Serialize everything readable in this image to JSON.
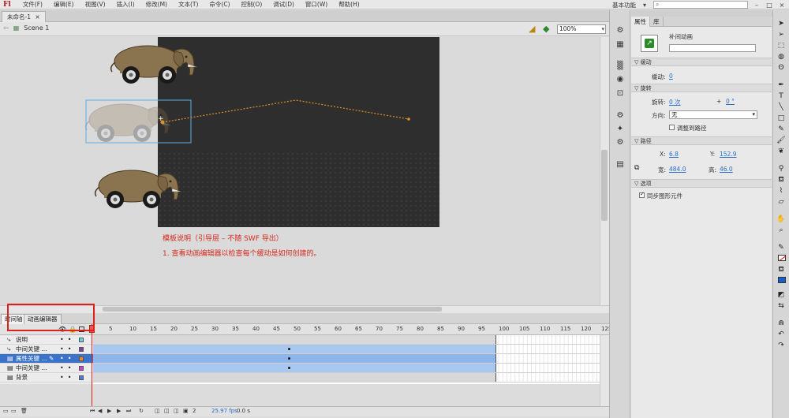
{
  "menubar": {
    "logo": "Fl",
    "items": [
      "文件(F)",
      "编辑(E)",
      "视图(V)",
      "插入(I)",
      "修改(M)",
      "文本(T)",
      "命令(C)",
      "控制(O)",
      "调试(D)",
      "窗口(W)",
      "帮助(H)"
    ],
    "workspace": "基本功能",
    "search_placeholder": ""
  },
  "document": {
    "tab_label": "未命名-1",
    "scene_label": "Scene 1",
    "zoom": "100%"
  },
  "stage": {
    "note_title": "模板说明（引导层 – 不随 SWF 导出）",
    "note_line1": "1. 查看动画编辑器以检查每个缓动是如何创建的。"
  },
  "timeline": {
    "tabs": [
      "时间轴",
      "动画编辑器"
    ],
    "ruler": [
      "5",
      "10",
      "15",
      "20",
      "25",
      "30",
      "35",
      "40",
      "45",
      "50",
      "55",
      "60",
      "65",
      "70",
      "75",
      "80",
      "85",
      "90",
      "95",
      "100",
      "105",
      "110",
      "115",
      "120",
      "125"
    ],
    "layers": [
      {
        "name": "说明",
        "icon": "guide-icon",
        "color": "#5ad8e0",
        "selected": false
      },
      {
        "name": "中间关键 ...",
        "icon": "motion-guide-icon",
        "color": "#8a3aa8",
        "selected": false
      },
      {
        "name": "属性关键 ...",
        "icon": "layer-icon",
        "color": "#f08a18",
        "selected": true
      },
      {
        "name": "中间关键 ...",
        "icon": "layer-icon",
        "color": "#e030e0",
        "selected": false
      },
      {
        "name": "背景",
        "icon": "layer-icon",
        "color": "#4a78e8",
        "selected": false
      }
    ],
    "fps": "25.97 fps",
    "time": "0.0 s",
    "current_frame": "2"
  },
  "properties": {
    "tabs": [
      "属性",
      "库"
    ],
    "instance_label": "补间动画",
    "sections": {
      "ease": "缓动",
      "ease_label": "缓动:",
      "ease_value": "0",
      "rotate": "旋转",
      "rotate_label": "旋转:",
      "rotate_times": "0 次",
      "rotate_plus": "+",
      "rotate_deg": "0 °",
      "direction_label": "方向:",
      "direction_value": "无",
      "orient_to_path": "调整到路径",
      "path": "路径",
      "x_label": "X:",
      "x_value": "6.8",
      "y_label": "Y:",
      "y_value": "152.9",
      "w_label": "宽:",
      "w_value": "484.0",
      "h_label": "高:",
      "h_value": "46.0",
      "options": "选项",
      "sync_symbols": "同步图形元件"
    }
  },
  "colors": {
    "stage": "#2e2e2e",
    "selection": "#3a73c8",
    "tween": "#a9c8ef",
    "note": "#d62a1e",
    "highlight_box": "#e0201c"
  }
}
